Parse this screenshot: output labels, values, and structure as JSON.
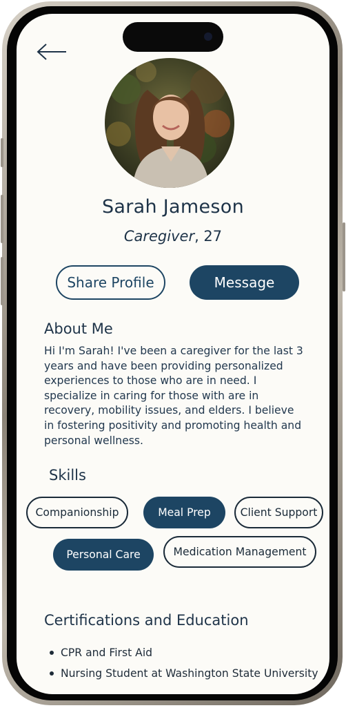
{
  "profile": {
    "name": "Sarah Jameson",
    "role": "Caregiver",
    "age_suffix": ", 27"
  },
  "actions": {
    "share_label": "Share Profile",
    "message_label": "Message"
  },
  "about": {
    "title": "About Me",
    "body": "Hi I'm Sarah! I've been a caregiver for the last 3 years and have been providing personalized experiences to those who are in need. I specialize in caring for those with are in recovery, mobility issues, and elders. I believe in fostering positivity and promoting health and personal wellness."
  },
  "skills": {
    "title": "Skills",
    "items": [
      {
        "label": "Companionship",
        "selected": false
      },
      {
        "label": "Meal Prep",
        "selected": true
      },
      {
        "label": "Client Support",
        "selected": false
      },
      {
        "label": "Personal Care",
        "selected": true
      },
      {
        "label": "Medication Management",
        "selected": false
      }
    ]
  },
  "certifications": {
    "title": "Certifications and Education",
    "items": [
      "CPR and First Aid",
      "Nursing Student at Washington State University"
    ]
  },
  "icons": {
    "back": "arrow-left-icon",
    "avatar": "profile-photo"
  },
  "colors": {
    "primary": "#1d4563",
    "text": "#1e3348",
    "background": "#fcfbf7"
  }
}
